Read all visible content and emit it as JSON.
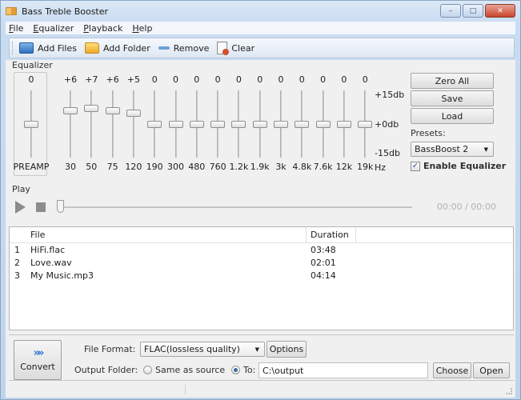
{
  "window": {
    "title": "Bass Treble Booster",
    "controls": {
      "minimize": "–",
      "maximize": "□",
      "close": "✕"
    }
  },
  "menubar": {
    "items": [
      {
        "label": "File",
        "mnemonic": "F"
      },
      {
        "label": "Equalizer",
        "mnemonic": "E"
      },
      {
        "label": "Playback",
        "mnemonic": "P"
      },
      {
        "label": "Help",
        "mnemonic": "H"
      }
    ]
  },
  "toolbar": {
    "add_files": "Add Files",
    "add_folder": "Add Folder",
    "remove": "Remove",
    "clear": "Clear"
  },
  "equalizer": {
    "group_label": "Equalizer",
    "preamp": {
      "label": "PREAMP",
      "value": "0",
      "db": 0
    },
    "bands": [
      {
        "label": "30",
        "value": "+6",
        "db": 6
      },
      {
        "label": "50",
        "value": "+7",
        "db": 7
      },
      {
        "label": "75",
        "value": "+6",
        "db": 6
      },
      {
        "label": "120",
        "value": "+5",
        "db": 5
      },
      {
        "label": "190",
        "value": "0",
        "db": 0
      },
      {
        "label": "300",
        "value": "0",
        "db": 0
      },
      {
        "label": "480",
        "value": "0",
        "db": 0
      },
      {
        "label": "760",
        "value": "0",
        "db": 0
      },
      {
        "label": "1.2k",
        "value": "0",
        "db": 0
      },
      {
        "label": "1.9k",
        "value": "0",
        "db": 0
      },
      {
        "label": "3k",
        "value": "0",
        "db": 0
      },
      {
        "label": "4.8k",
        "value": "0",
        "db": 0
      },
      {
        "label": "7.6k",
        "value": "0",
        "db": 0
      },
      {
        "label": "12k",
        "value": "0",
        "db": 0
      },
      {
        "label": "19k",
        "value": "0",
        "db": 0
      }
    ],
    "range_db": [
      -15,
      15
    ],
    "scale": {
      "top": "+15db",
      "mid": "+0db",
      "bottom": "-15db",
      "unit": "Hz"
    },
    "buttons": {
      "zero_all": "Zero All",
      "save": "Save",
      "load": "Load"
    },
    "presets_label": "Presets:",
    "preset_selected": "BassBoost 2",
    "enable_label": "Enable Equalizer",
    "enabled": true
  },
  "play": {
    "group_label": "Play",
    "time": "00:00 / 00:00",
    "position_fraction": 0
  },
  "file_list": {
    "columns": [
      "File",
      "Duration"
    ],
    "rows": [
      {
        "index": "1",
        "file": "HiFi.flac",
        "duration": "03:48"
      },
      {
        "index": "2",
        "file": "Love.wav",
        "duration": "02:01"
      },
      {
        "index": "3",
        "file": "My Music.mp3",
        "duration": "04:14"
      }
    ]
  },
  "convert": {
    "button_label": "Convert",
    "button_icon": "»",
    "file_format_label": "File Format:",
    "file_format_value": "FLAC(lossless quality)",
    "options_label": "Options",
    "output_folder_label": "Output Folder:",
    "same_as_source_label": "Same as source",
    "to_label": "To:",
    "output_path": "C:\\output",
    "selected_output": "to",
    "choose_label": "Choose",
    "open_label": "Open"
  }
}
